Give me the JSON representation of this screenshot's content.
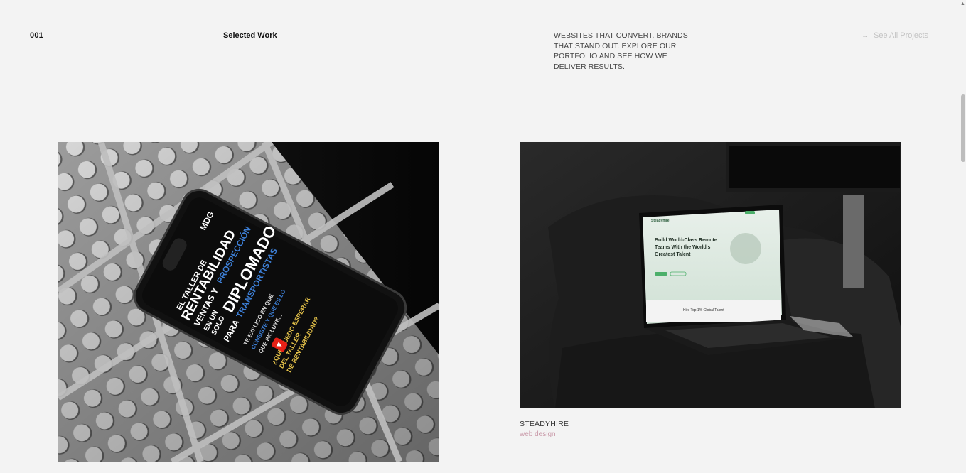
{
  "section": {
    "number": "001",
    "title": "Selected Work",
    "tagline": "WEBSITES THAT CONVERT, BRANDS THAT STAND OUT. EXPLORE OUR PORTFOLIO AND SEE HOW WE DELIVER RESULTS.",
    "see_all_label": "See All Projects",
    "see_all_icon": "arrow-right-icon"
  },
  "projects": [
    {
      "image_alt": "Mobile phone mockup on perforated metal surface",
      "phone_text": {
        "line1": "EL TALLER DE",
        "line2": "RENTABILIDAD",
        "line3": "VENTAS Y",
        "line4": "PROSPECCIÓN",
        "line5": "EN UN",
        "line6": "SOLO",
        "line7": "DIPLOMADO",
        "line8": "PARA",
        "line9": "TRANSPORTISTAS",
        "line10": "TE EXPLICO EN QUE",
        "line11": "CONSISTE Y QUE ES LO",
        "line12": "QUE INCLUYE...",
        "line13": "¿QUE PUEDO ESPERAR",
        "line14": "DEL TALLER",
        "line15": "DE RENTABILIDAD?",
        "logo": "MDG"
      }
    },
    {
      "image_alt": "Laptop mockup on dark sofa",
      "laptop_text": {
        "logo": "Steadyhire",
        "headline_1": "Build World-Class Remote",
        "headline_2": "Teams With the World's",
        "headline_3": "Greatest Talent",
        "footer": "Hire Top 1% Global Talent"
      },
      "title": "STEADYHIRE",
      "subtitle": "web design"
    }
  ],
  "colors": {
    "background": "#f3f3f3",
    "muted_link": "#c4c4c4",
    "subtitle_pink": "#c99aa9",
    "youtube_red": "#e62117",
    "accent_blue": "#3d7fd6",
    "accent_yellow": "#e6c34a",
    "site_green": "#4caf6a"
  }
}
